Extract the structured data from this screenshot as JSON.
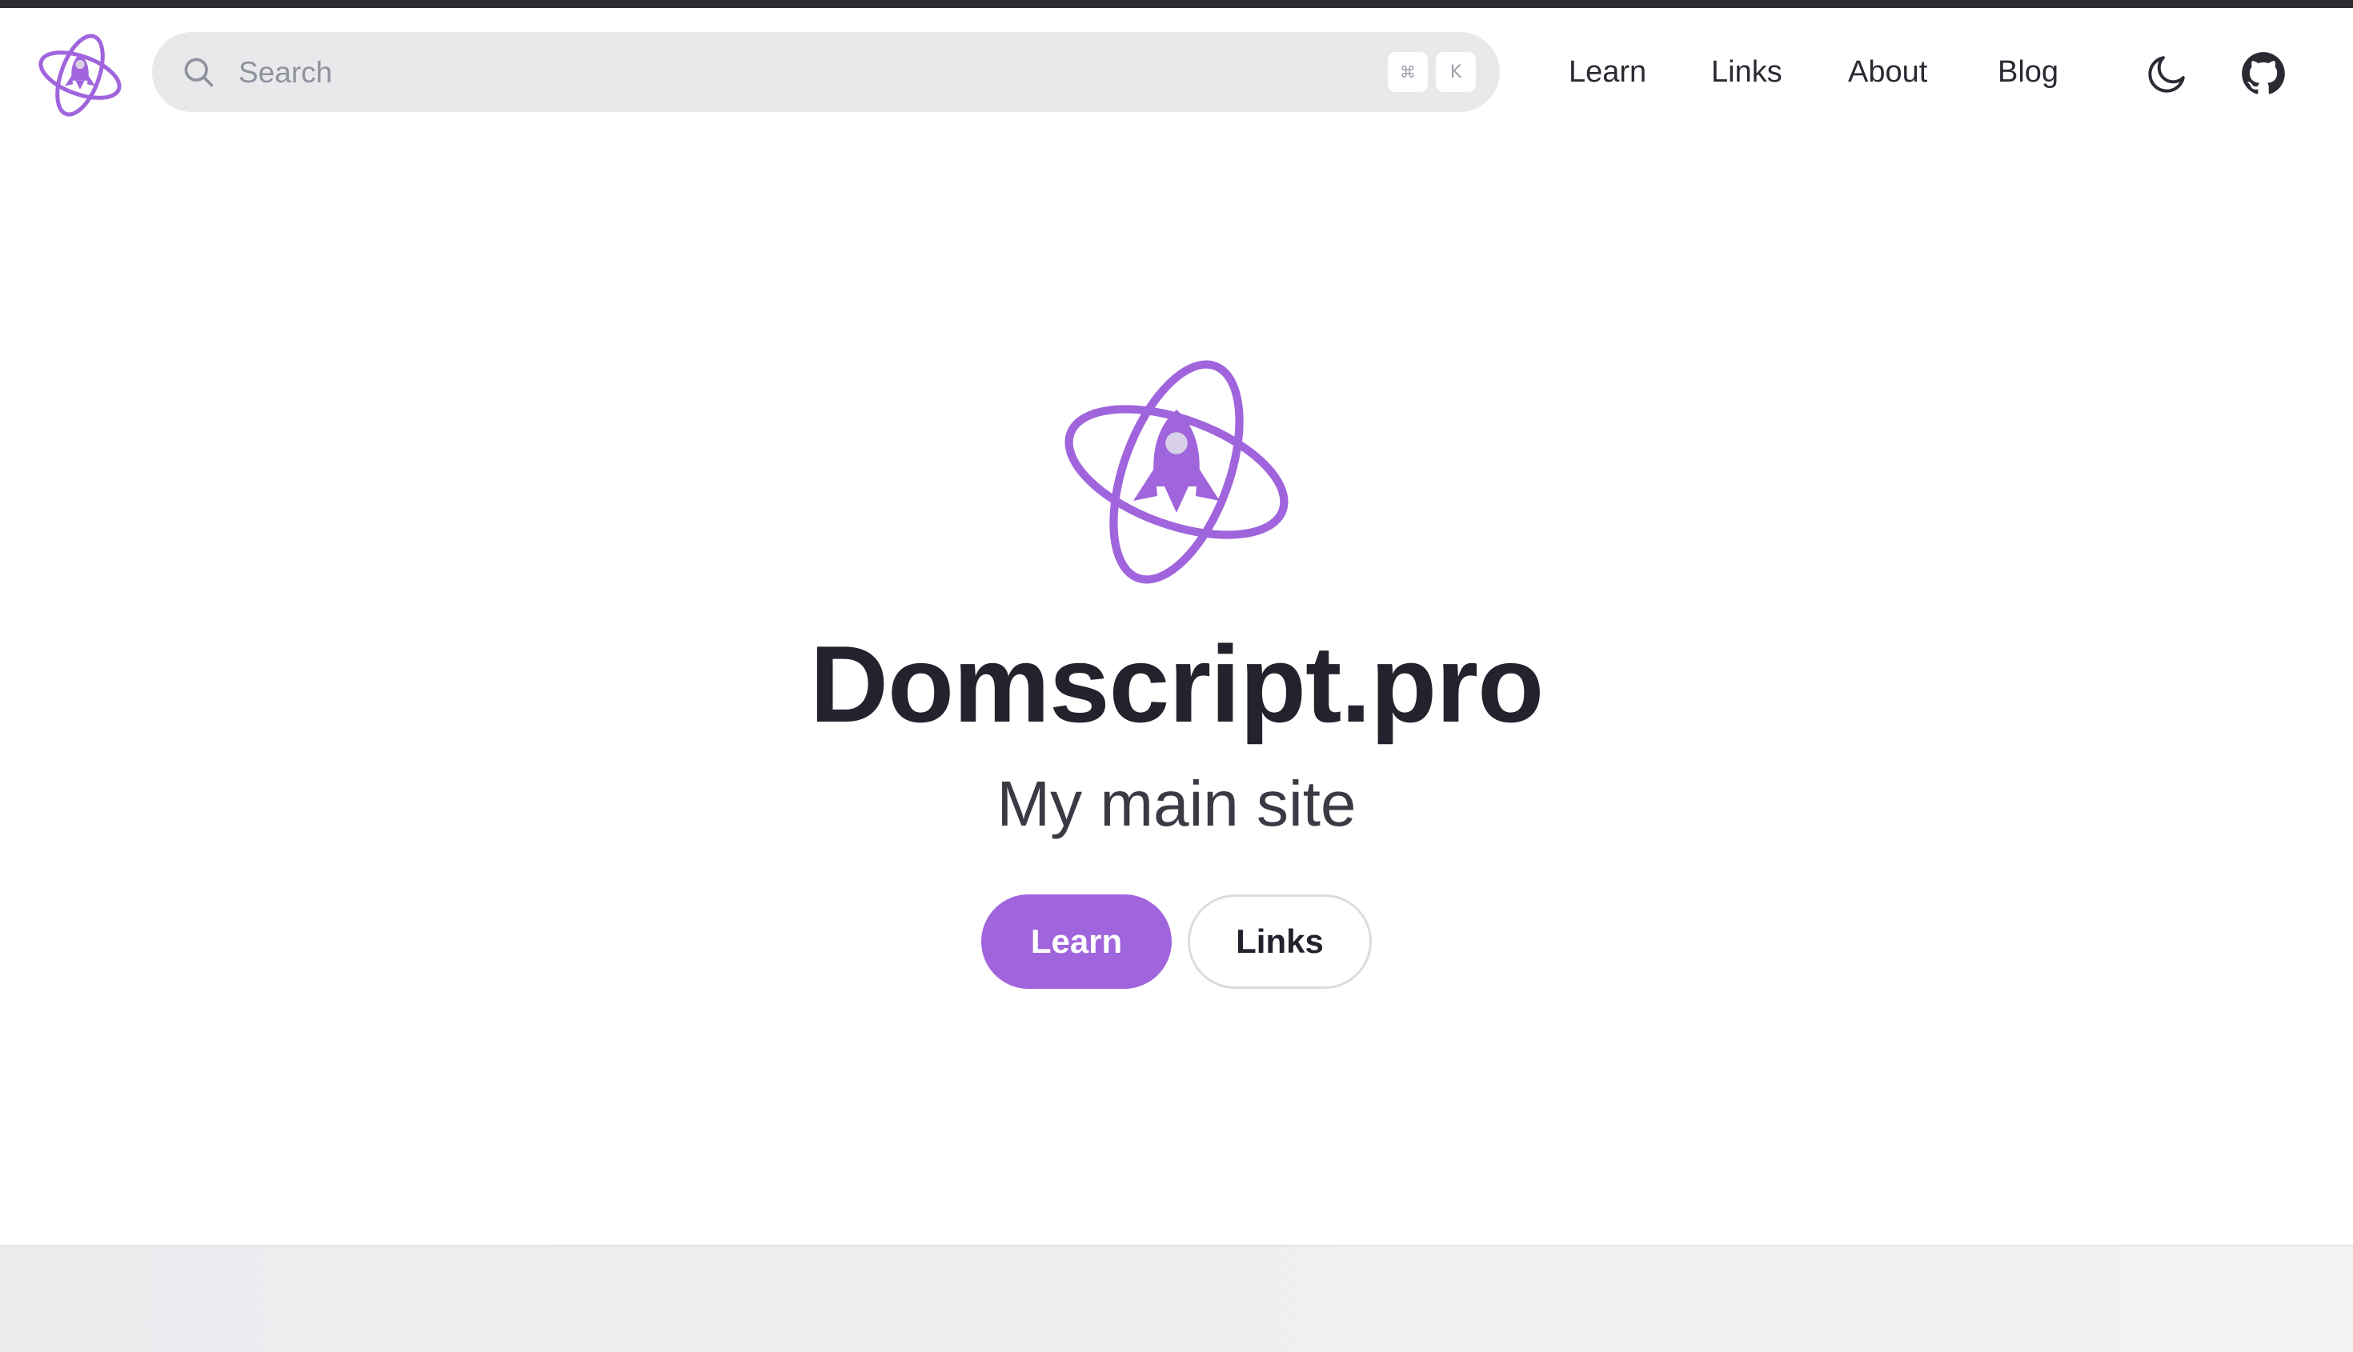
{
  "colors": {
    "brand": "#a064dc",
    "text_dark": "#23232e",
    "search_bg": "#e9e9ec",
    "placeholder": "#8e939e"
  },
  "header": {
    "logo_icon": "domscript-atom-rocket-logo",
    "search": {
      "placeholder": "Search",
      "value": "",
      "shortcut_modifier": "⌘",
      "shortcut_key": "K",
      "icon": "search-icon"
    },
    "nav": [
      {
        "label": "Learn"
      },
      {
        "label": "Links"
      },
      {
        "label": "About"
      },
      {
        "label": "Blog"
      }
    ],
    "theme_toggle_icon": "moon-icon",
    "github_icon": "github-icon"
  },
  "hero": {
    "logo_icon": "domscript-atom-rocket-logo",
    "title": "Domscript.pro",
    "tagline": "My main site",
    "primary_button": "Learn",
    "secondary_button": "Links"
  }
}
